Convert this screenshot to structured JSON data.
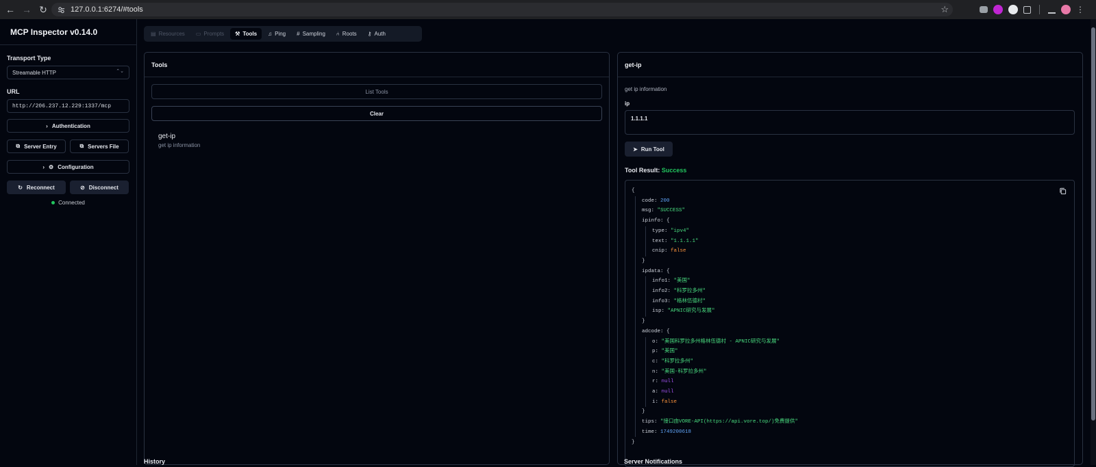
{
  "browser": {
    "url": "127.0.0.1:6274/#tools",
    "back_icon": "←",
    "forward_icon": "→",
    "reload_icon": "↻"
  },
  "sidebar": {
    "title": "MCP Inspector v0.14.0",
    "transport_label": "Transport Type",
    "transport_value": "Streamable HTTP",
    "url_label": "URL",
    "url_value": "http://206.237.12.229:1337/mcp",
    "auth_label": "Authentication",
    "server_entry_label": "Server Entry",
    "servers_file_label": "Servers File",
    "configuration_label": "Configuration",
    "reconnect_label": "Reconnect",
    "disconnect_label": "Disconnect",
    "status": "Connected"
  },
  "tabs": [
    {
      "label": "Resources",
      "icon": "resources-icon",
      "state": "disabled"
    },
    {
      "label": "Prompts",
      "icon": "prompts-icon",
      "state": "disabled"
    },
    {
      "label": "Tools",
      "icon": "wrench-icon",
      "state": "active"
    },
    {
      "label": "Ping",
      "icon": "bell-icon",
      "state": "normal"
    },
    {
      "label": "Sampling",
      "icon": "hash-icon",
      "state": "normal"
    },
    {
      "label": "Roots",
      "icon": "roots-icon",
      "state": "normal"
    },
    {
      "label": "Auth",
      "icon": "key-icon",
      "state": "normal"
    }
  ],
  "tools_panel": {
    "title": "Tools",
    "list_tools_label": "List Tools",
    "clear_label": "Clear",
    "tool": {
      "name": "get-ip",
      "description": "get ip information"
    }
  },
  "result_panel": {
    "title": "get-ip",
    "description": "get ip information",
    "param_label": "ip",
    "param_value": "1.1.1.1",
    "run_label": "Run Tool",
    "result_label": "Tool Result:",
    "result_status": "Success",
    "json_lines": [
      {
        "indent": 0,
        "text": "{",
        "type": "punct"
      },
      {
        "indent": 1,
        "key": "code",
        "value": "200",
        "type": "number"
      },
      {
        "indent": 1,
        "key": "msg",
        "value": "\"SUCCESS\"",
        "type": "string"
      },
      {
        "indent": 1,
        "key": "ipinfo",
        "value": "{",
        "type": "punct"
      },
      {
        "indent": 2,
        "key": "type",
        "value": "\"ipv4\"",
        "type": "string"
      },
      {
        "indent": 2,
        "key": "text",
        "value": "\"1.1.1.1\"",
        "type": "string"
      },
      {
        "indent": 2,
        "key": "cnip",
        "value": "false",
        "type": "bool"
      },
      {
        "indent": 1,
        "text": "}",
        "type": "punct"
      },
      {
        "indent": 1,
        "key": "ipdata",
        "value": "{",
        "type": "punct"
      },
      {
        "indent": 2,
        "key": "info1",
        "value": "\"美国\"",
        "type": "string"
      },
      {
        "indent": 2,
        "key": "info2",
        "value": "\"科罗拉多州\"",
        "type": "string"
      },
      {
        "indent": 2,
        "key": "info3",
        "value": "\"格林伍德村\"",
        "type": "string"
      },
      {
        "indent": 2,
        "key": "isp",
        "value": "\"APNIC研究与发展\"",
        "type": "string"
      },
      {
        "indent": 1,
        "text": "}",
        "type": "punct"
      },
      {
        "indent": 1,
        "key": "adcode",
        "value": "{",
        "type": "punct"
      },
      {
        "indent": 2,
        "key": "o",
        "value": "\"美国科罗拉多州格林伍德村 - APNIC研究与发展\"",
        "type": "string"
      },
      {
        "indent": 2,
        "key": "p",
        "value": "\"美国\"",
        "type": "string"
      },
      {
        "indent": 2,
        "key": "c",
        "value": "\"科罗拉多州\"",
        "type": "string"
      },
      {
        "indent": 2,
        "key": "n",
        "value": "\"美国-科罗拉多州\"",
        "type": "string"
      },
      {
        "indent": 2,
        "key": "r",
        "value": "null",
        "type": "null"
      },
      {
        "indent": 2,
        "key": "a",
        "value": "null",
        "type": "null"
      },
      {
        "indent": 2,
        "key": "i",
        "value": "false",
        "type": "bool"
      },
      {
        "indent": 1,
        "text": "}",
        "type": "punct"
      },
      {
        "indent": 1,
        "key": "tips",
        "value": "\"接口由VORE-API(https://api.vore.top/)免费提供\"",
        "type": "string"
      },
      {
        "indent": 1,
        "key": "time",
        "value": "1749200618",
        "type": "number"
      },
      {
        "indent": 0,
        "text": "}",
        "type": "punct"
      }
    ]
  },
  "bottom": {
    "left_title": "History",
    "right_title": "Server Notifications"
  }
}
